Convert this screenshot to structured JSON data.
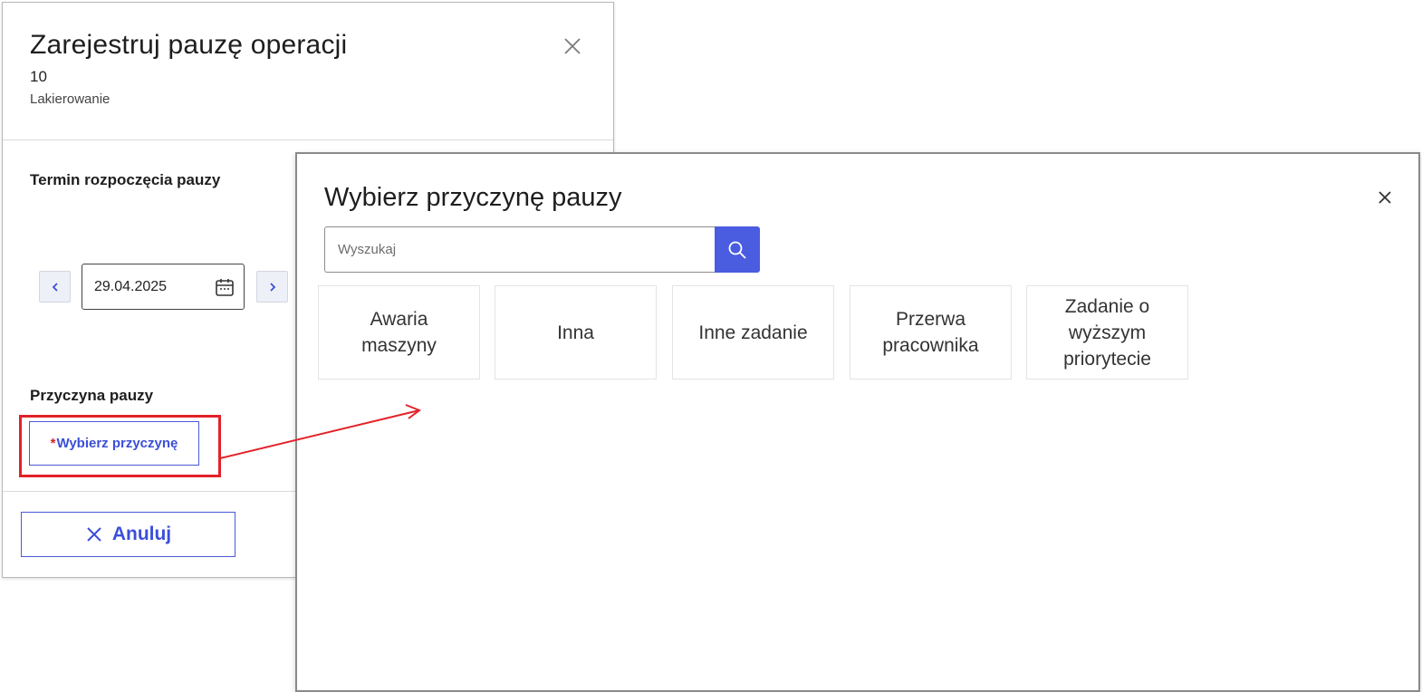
{
  "pause_dialog": {
    "title": "Zarejestruj pauzę operacji",
    "operation_number": "10",
    "operation_name": "Lakierowanie",
    "start_section_label": "Termin rozpoczęcia pauzy",
    "date_value": "29.04.2025",
    "reason_section_label": "Przyczyna pauzy",
    "required_marker": "*",
    "choose_reason_label": "Wybierz przyczynę",
    "cancel_label": "Anuluj"
  },
  "reason_dialog": {
    "title": "Wybierz przyczynę pauzy",
    "search_placeholder": "Wyszukaj",
    "reasons": [
      "Awaria maszyny",
      "Inna",
      "Inne zadanie",
      "Przerwa pracownika",
      "Zadanie o wyższym priorytecie"
    ]
  },
  "annotation": {
    "highlight_color": "#e32129"
  },
  "colors": {
    "accent": "#4a5ce0",
    "required": "#d8202b"
  },
  "icons": [
    "close-icon",
    "chevron-left-icon",
    "chevron-right-icon",
    "calendar-icon",
    "search-icon",
    "x-icon"
  ]
}
